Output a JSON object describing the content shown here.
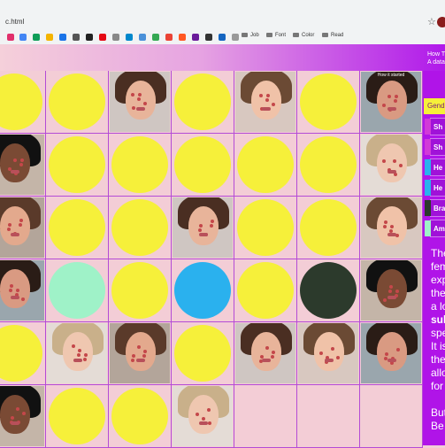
{
  "browser": {
    "url": "c.html",
    "bookmark_folders": [
      "Job",
      "Font",
      "Color",
      "Read"
    ]
  },
  "header": {
    "title_line1": "How T",
    "title_line2": "A data"
  },
  "grid": {
    "caption": "How it started",
    "rows": [
      [
        "yellow",
        "yellow",
        "photo",
        "yellow",
        "photo",
        "yellow",
        "photo"
      ],
      [
        "photo",
        "yellow",
        "yellow",
        "yellow",
        "yellow",
        "yellow",
        "photo"
      ],
      [
        "photo",
        "yellow",
        "yellow",
        "photo",
        "yellow",
        "yellow",
        "photo"
      ],
      [
        "photo",
        "mint",
        "yellow",
        "blue",
        "yellow",
        "dark",
        "photo"
      ],
      [
        "yellow",
        "photo",
        "photo",
        "yellow",
        "photo",
        "photo",
        "photo"
      ],
      [
        "photo",
        "yellow",
        "yellow",
        "photo",
        "empty",
        "empty",
        "empty"
      ]
    ],
    "colors": {
      "yellow": "#f6f03a",
      "mint": "#9ff2c8",
      "blue": "#2ab1ee",
      "dark": "#2c3a2c",
      "border": "#b44bd6",
      "panel": "#b014e8"
    }
  },
  "sidebar": {
    "gender_label": "Gend",
    "tags": [
      {
        "label": "Sh",
        "color": "#d23ad8"
      },
      {
        "label": "Sh",
        "color": "#d23ad8"
      },
      {
        "label": "He",
        "color": "#2ab1ee"
      },
      {
        "label": "He",
        "color": "#2ab1ee"
      },
      {
        "label": "Bra",
        "color": "#2c3a2c"
      },
      {
        "label": "Am",
        "color": "#9ff2c8"
      }
    ],
    "paragraph_lines": [
      "The",
      "fem",
      "exp",
      "the",
      "a lo",
      "sul",
      "spe",
      "It is",
      "the",
      "allo",
      "for",
      "",
      "But",
      "Be"
    ]
  }
}
